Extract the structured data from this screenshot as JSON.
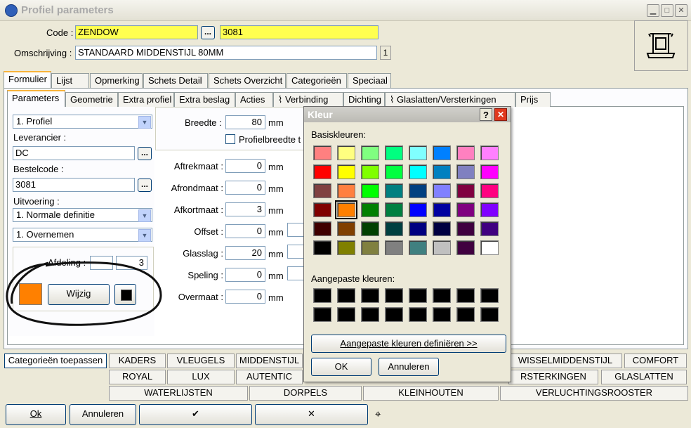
{
  "window": {
    "title": "Profiel parameters"
  },
  "header": {
    "code_label": "Code :",
    "code_value": "ZENDOW",
    "code_button": "...",
    "code_value2": "3081",
    "omschrijving_label": "Omschrijving :",
    "omschrijving_value": "STANDAARD MIDDENSTIJL 80MM",
    "omschrijving_count": "1"
  },
  "main_tabs": [
    "Formulier",
    "Lijst",
    "Opmerking",
    "Schets Detail",
    "Schets Overzicht",
    "Categorieën",
    "Speciaal"
  ],
  "sub_tabs": [
    "Parameters",
    "Geometrie",
    "Extra profiel",
    "Extra beslag",
    "Acties",
    "Verbinding",
    "Dichting",
    "Glaslatten/Versterkingen",
    "Prijs"
  ],
  "left_panel": {
    "profile_select": "1. Profiel",
    "leverancier_label": "Leverancier :",
    "leverancier_value": "DC",
    "bestelcode_label": "Bestelcode :",
    "bestelcode_value": "3081",
    "uitvoering_label": "Uitvoering :",
    "uitvoering_select": "1. Normale definitie",
    "overnemen_select": "1. Overnemen",
    "afdeling_label": "Afdeling :",
    "afdeling_value": "3",
    "wijzig_button": "Wijzig",
    "color_swatch": "#ff8000"
  },
  "mid_panel": {
    "breedte_label": "Breedte :",
    "breedte_value": "80",
    "unit": "mm",
    "profielbreedte_label": "Profielbreedte t",
    "rows": [
      {
        "label": "Aftrekmaat :",
        "value": "0",
        "unit": "mm"
      },
      {
        "label": "Afrondmaat :",
        "value": "0",
        "unit": "mm"
      },
      {
        "label": "Afkortmaat :",
        "value": "3",
        "unit": "mm"
      },
      {
        "label": "Offset :",
        "value": "0",
        "unit": "mm"
      },
      {
        "label": "Glasslag :",
        "value": "20",
        "unit": "mm"
      },
      {
        "label": "Speling :",
        "value": "0",
        "unit": "mm"
      },
      {
        "label": "Overmaat :",
        "value": "0",
        "unit": "mm"
      }
    ]
  },
  "color_dialog": {
    "title": "Kleur",
    "help": "?",
    "basis_label": "Basiskleuren:",
    "custom_label": "Aangepaste kleuren:",
    "define_button": "Aangepaste kleuren definiëren >>",
    "ok": "OK",
    "cancel": "Annuleren",
    "basic_colors": [
      [
        "#ff8080",
        "#ffff80",
        "#80ff80",
        "#00ff80",
        "#80ffff",
        "#0080ff",
        "#ff80c0",
        "#ff80ff"
      ],
      [
        "#ff0000",
        "#ffff00",
        "#80ff00",
        "#00ff40",
        "#00ffff",
        "#0080c0",
        "#8080c0",
        "#ff00ff"
      ],
      [
        "#804040",
        "#ff8040",
        "#00ff00",
        "#008080",
        "#004080",
        "#8080ff",
        "#800040",
        "#ff0080"
      ],
      [
        "#800000",
        "#ff8000",
        "#008000",
        "#008040",
        "#0000ff",
        "#0000a0",
        "#800080",
        "#8000ff"
      ],
      [
        "#400000",
        "#804000",
        "#004000",
        "#004040",
        "#000080",
        "#000040",
        "#400040",
        "#400080"
      ],
      [
        "#000000",
        "#808000",
        "#808040",
        "#808080",
        "#408080",
        "#c0c0c0",
        "#400040",
        "#ffffff"
      ]
    ],
    "selected_color": "#ff8000"
  },
  "categories": {
    "apply_button": "Categorieën toepassen",
    "row1": [
      "KADERS",
      "VLEUGELS",
      "MIDDENSTIJL",
      "WISSELMIDDENSTIJL",
      "COMFORT"
    ],
    "row2": [
      "ROYAL",
      "LUX",
      "AUTENTIC",
      "RSTERKINGEN",
      "GLASLATTEN"
    ],
    "row3": [
      "WATERLIJSTEN",
      "DORPELS",
      "KLEINHOUTEN",
      "VERLUCHTINGSROOSTER"
    ]
  },
  "bottom": {
    "ok": "Ok",
    "cancel": "Annuleren",
    "check": "✔",
    "cross": "✕"
  }
}
